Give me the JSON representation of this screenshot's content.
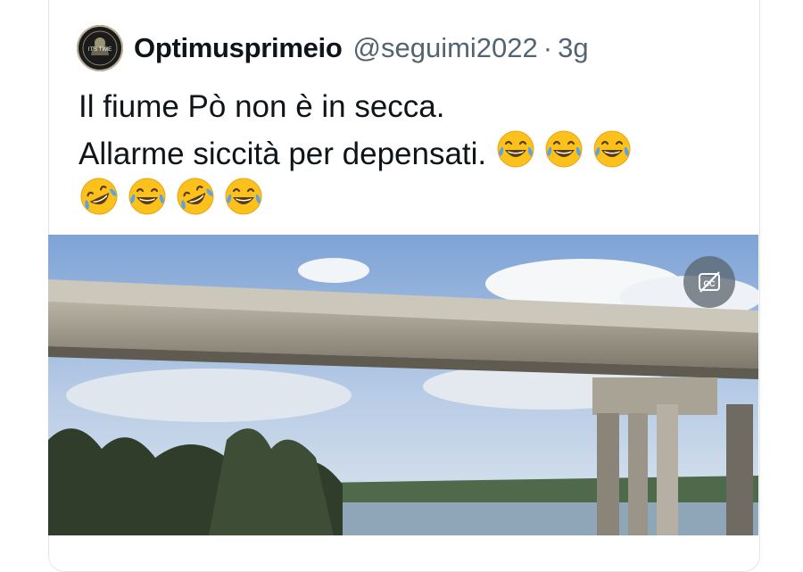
{
  "tweet": {
    "display_name": "Optimusprimeio",
    "handle": "@seguimi2022",
    "separator": "·",
    "time": "3g",
    "lines": [
      "Il fiume Pò non è in secca.",
      "Allarme siccità per depensati."
    ],
    "emoji_line2": [
      "joy",
      "joy",
      "joy"
    ],
    "emoji_line3": [
      "rofl",
      "joy",
      "rofl",
      "joy"
    ],
    "avatar_text": "IT'S TIME"
  },
  "media": {
    "description_icon": "captions-off-icon",
    "cc_label": "CC"
  },
  "colors": {
    "text": "#0f1419",
    "muted": "#536471",
    "border": "#e3e6e9"
  }
}
